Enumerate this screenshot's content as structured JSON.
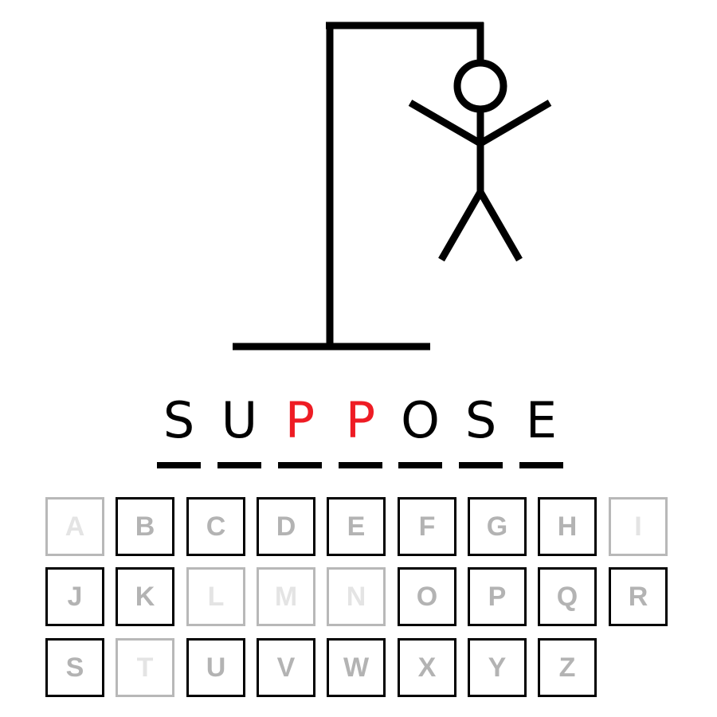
{
  "game": {
    "wrong_guesses": 6
  },
  "word": {
    "letters": [
      {
        "char": "S",
        "state": "revealed"
      },
      {
        "char": "U",
        "state": "revealed"
      },
      {
        "char": "P",
        "state": "missed"
      },
      {
        "char": "P",
        "state": "missed"
      },
      {
        "char": "O",
        "state": "revealed"
      },
      {
        "char": "S",
        "state": "revealed"
      },
      {
        "char": "E",
        "state": "revealed"
      }
    ]
  },
  "keyboard": {
    "rows": [
      [
        {
          "label": "A",
          "state": "used"
        },
        {
          "label": "B",
          "state": "available"
        },
        {
          "label": "C",
          "state": "available"
        },
        {
          "label": "D",
          "state": "available"
        },
        {
          "label": "E",
          "state": "available"
        },
        {
          "label": "F",
          "state": "available"
        },
        {
          "label": "G",
          "state": "available"
        },
        {
          "label": "H",
          "state": "available"
        },
        {
          "label": "I",
          "state": "used"
        }
      ],
      [
        {
          "label": "J",
          "state": "available"
        },
        {
          "label": "K",
          "state": "available"
        },
        {
          "label": "L",
          "state": "used"
        },
        {
          "label": "M",
          "state": "used"
        },
        {
          "label": "N",
          "state": "used"
        },
        {
          "label": "O",
          "state": "available"
        },
        {
          "label": "P",
          "state": "available"
        },
        {
          "label": "Q",
          "state": "available"
        },
        {
          "label": "R",
          "state": "available"
        }
      ],
      [
        {
          "label": "S",
          "state": "available"
        },
        {
          "label": "T",
          "state": "used"
        },
        {
          "label": "U",
          "state": "available"
        },
        {
          "label": "V",
          "state": "available"
        },
        {
          "label": "W",
          "state": "available"
        },
        {
          "label": "X",
          "state": "available"
        },
        {
          "label": "Y",
          "state": "available"
        },
        {
          "label": "Z",
          "state": "available"
        }
      ]
    ]
  },
  "colors": {
    "revealed": "#000000",
    "missed": "#ee1c24",
    "key_text": "#b3b3b3",
    "key_border": "#000000",
    "used_text": "#e4e4e4",
    "used_border": "#b8b8b8"
  }
}
